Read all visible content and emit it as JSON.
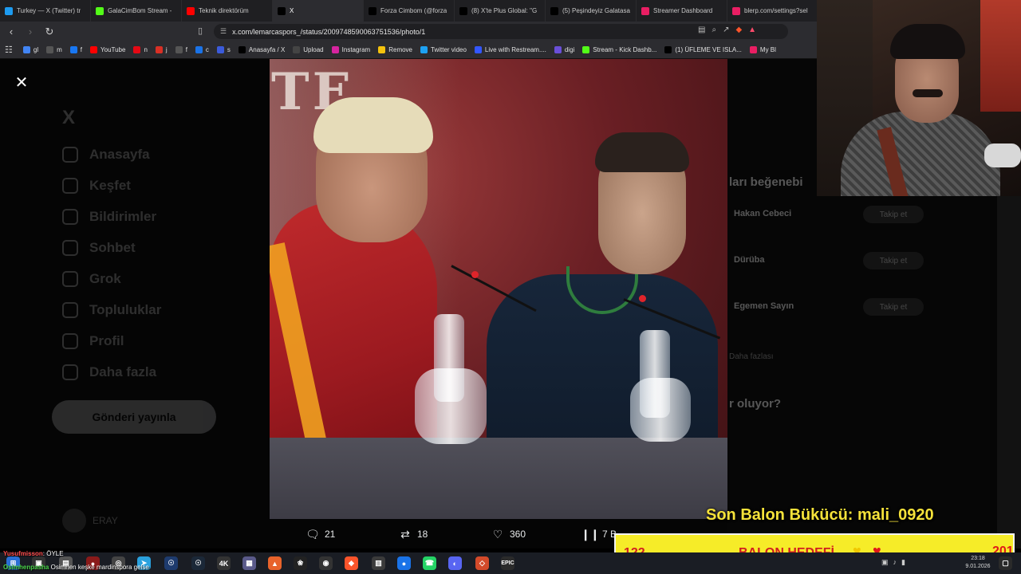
{
  "browser": {
    "tabs": [
      {
        "title": "Turkey — X (Twitter) tr",
        "icon": "x-icon",
        "color": "#1d9bf0"
      },
      {
        "title": "GalaCimBom Stream -",
        "icon": "kick-icon",
        "color": "#53fc18"
      },
      {
        "title": "Teknik direktörüm",
        "icon": "youtube-icon",
        "color": "#ff0000"
      },
      {
        "title": "X",
        "icon": "x-icon",
        "color": "#000000",
        "active": true
      },
      {
        "title": "Forza Cimbom (@forza",
        "icon": "x-icon",
        "color": "#000000"
      },
      {
        "title": "(8) X'te Plus Global: \"G",
        "icon": "x-icon",
        "color": "#000000"
      },
      {
        "title": "(5) Peşindeyiz Galatasa",
        "icon": "x-icon",
        "color": "#000000"
      },
      {
        "title": "Streamer Dashboard",
        "icon": "streamer-icon",
        "color": "#e91e63"
      },
      {
        "title": "blerp.com/settings?sel",
        "icon": "blerp-icon",
        "color": "#e91e63"
      }
    ],
    "url": "x.com/lemarcaspors_/status/2009748590063751536/photo/1",
    "bookmarks": [
      {
        "label": "gl",
        "color": "#4285f4"
      },
      {
        "label": "m",
        "color": "#555555"
      },
      {
        "label": "f",
        "color": "#1877f2"
      },
      {
        "label": "YouTube",
        "color": "#ff0000"
      },
      {
        "label": "n",
        "color": "#e50914"
      },
      {
        "label": "j",
        "color": "#d93025"
      },
      {
        "label": "f",
        "color": "#555555"
      },
      {
        "label": "c",
        "color": "#1a73e8"
      },
      {
        "label": "s",
        "color": "#3b5bdb"
      },
      {
        "label": "Anasayfa / X",
        "color": "#000000"
      },
      {
        "label": "Upload",
        "color": "#444444"
      },
      {
        "label": "Instagram",
        "color": "#d6249f"
      },
      {
        "label": "Remove",
        "color": "#f4c20d"
      },
      {
        "label": "Twitter video",
        "color": "#1da1f2"
      },
      {
        "label": "Live with Restream....",
        "color": "#3357ff"
      },
      {
        "label": "digi",
        "color": "#6a4fd8"
      },
      {
        "label": "Stream - Kick Dashb...",
        "color": "#53fc18"
      },
      {
        "label": "(1) ÜFLEME VE ISLA...",
        "color": "#000000"
      },
      {
        "label": "My Bl",
        "color": "#e91e63"
      }
    ]
  },
  "x_sidebar": {
    "logo": "X",
    "items": [
      "Anasayfa",
      "Keşfet",
      "Bildirimler",
      "Sohbet",
      "Grok",
      "Topluluklar",
      "Profil",
      "Daha fazla"
    ],
    "post_button": "Gönderi yayınla",
    "account_name": "ERAY"
  },
  "right_column": {
    "section_title": "ları beğenebi",
    "suggestions": [
      {
        "name": "Hakan Cebeci",
        "button": "Takip et"
      },
      {
        "name": "Dürüba",
        "button": "Takip et"
      },
      {
        "name": "Egemen Sayın",
        "button": "Takip et"
      }
    ],
    "show_more": "Daha fazlası",
    "whats_happening": "r oluyor?"
  },
  "tweet_actions": {
    "replies": "21",
    "retweets": "18",
    "likes": "360",
    "views": "7 B"
  },
  "overlay": {
    "balon_label": "Son Balon Bükücü: mali_0920",
    "goal_current": "122",
    "goal_label": "BALON HEDEFİ",
    "goal_target": "201",
    "goal_progress": 0.607
  },
  "chat": {
    "line1_user": "Yusufmisson",
    "line1_text": ": ÖYLE",
    "line2_user": "Osimhenpasha",
    "line2_text": "Osimhen keşke mardinspora gelse"
  },
  "taskbar": {
    "clock_time": "23:18",
    "clock_date": "9.01.2026"
  }
}
